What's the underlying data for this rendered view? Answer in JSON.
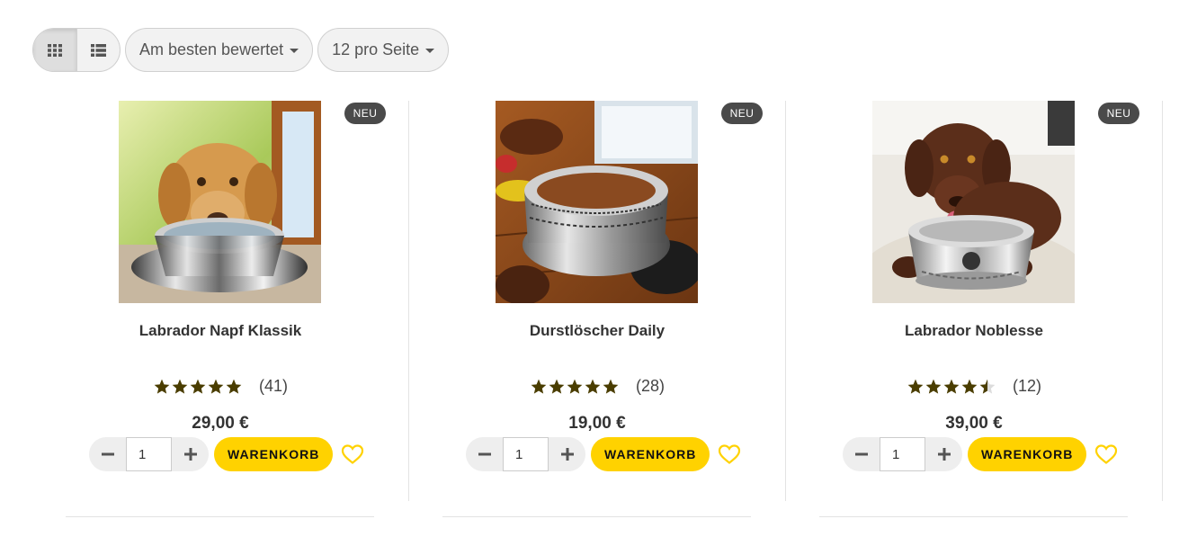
{
  "toolbar": {
    "view_grid_icon": "grid-icon",
    "view_list_icon": "list-icon",
    "sort_label": "Am besten bewertet",
    "per_page_label": "12 pro Seite"
  },
  "colors": {
    "accent": "#ffd200",
    "star": "#4a3d00",
    "badge": "#4a4a4a"
  },
  "products": [
    {
      "badge": "NEU",
      "title": "Labrador Napf Klassik",
      "rating": 5,
      "rating_count": "(41)",
      "price": "29,00 €",
      "quantity": "1",
      "cart_label": "WARENKORB",
      "image": "yellow labrador drinking from steel bowl"
    },
    {
      "badge": "NEU",
      "title": "Durstlöscher Daily",
      "rating": 5,
      "rating_count": "(28)",
      "price": "19,00 €",
      "quantity": "1",
      "cart_label": "WARENKORB",
      "image": "patterned dog bowl on wooden floor"
    },
    {
      "badge": "NEU",
      "title": "Labrador Noblesse",
      "rating": 4.5,
      "rating_count": "(12)",
      "price": "39,00 €",
      "quantity": "1",
      "cart_label": "WARENKORB",
      "image": "chocolate labrador with engraved steel bowl"
    }
  ]
}
